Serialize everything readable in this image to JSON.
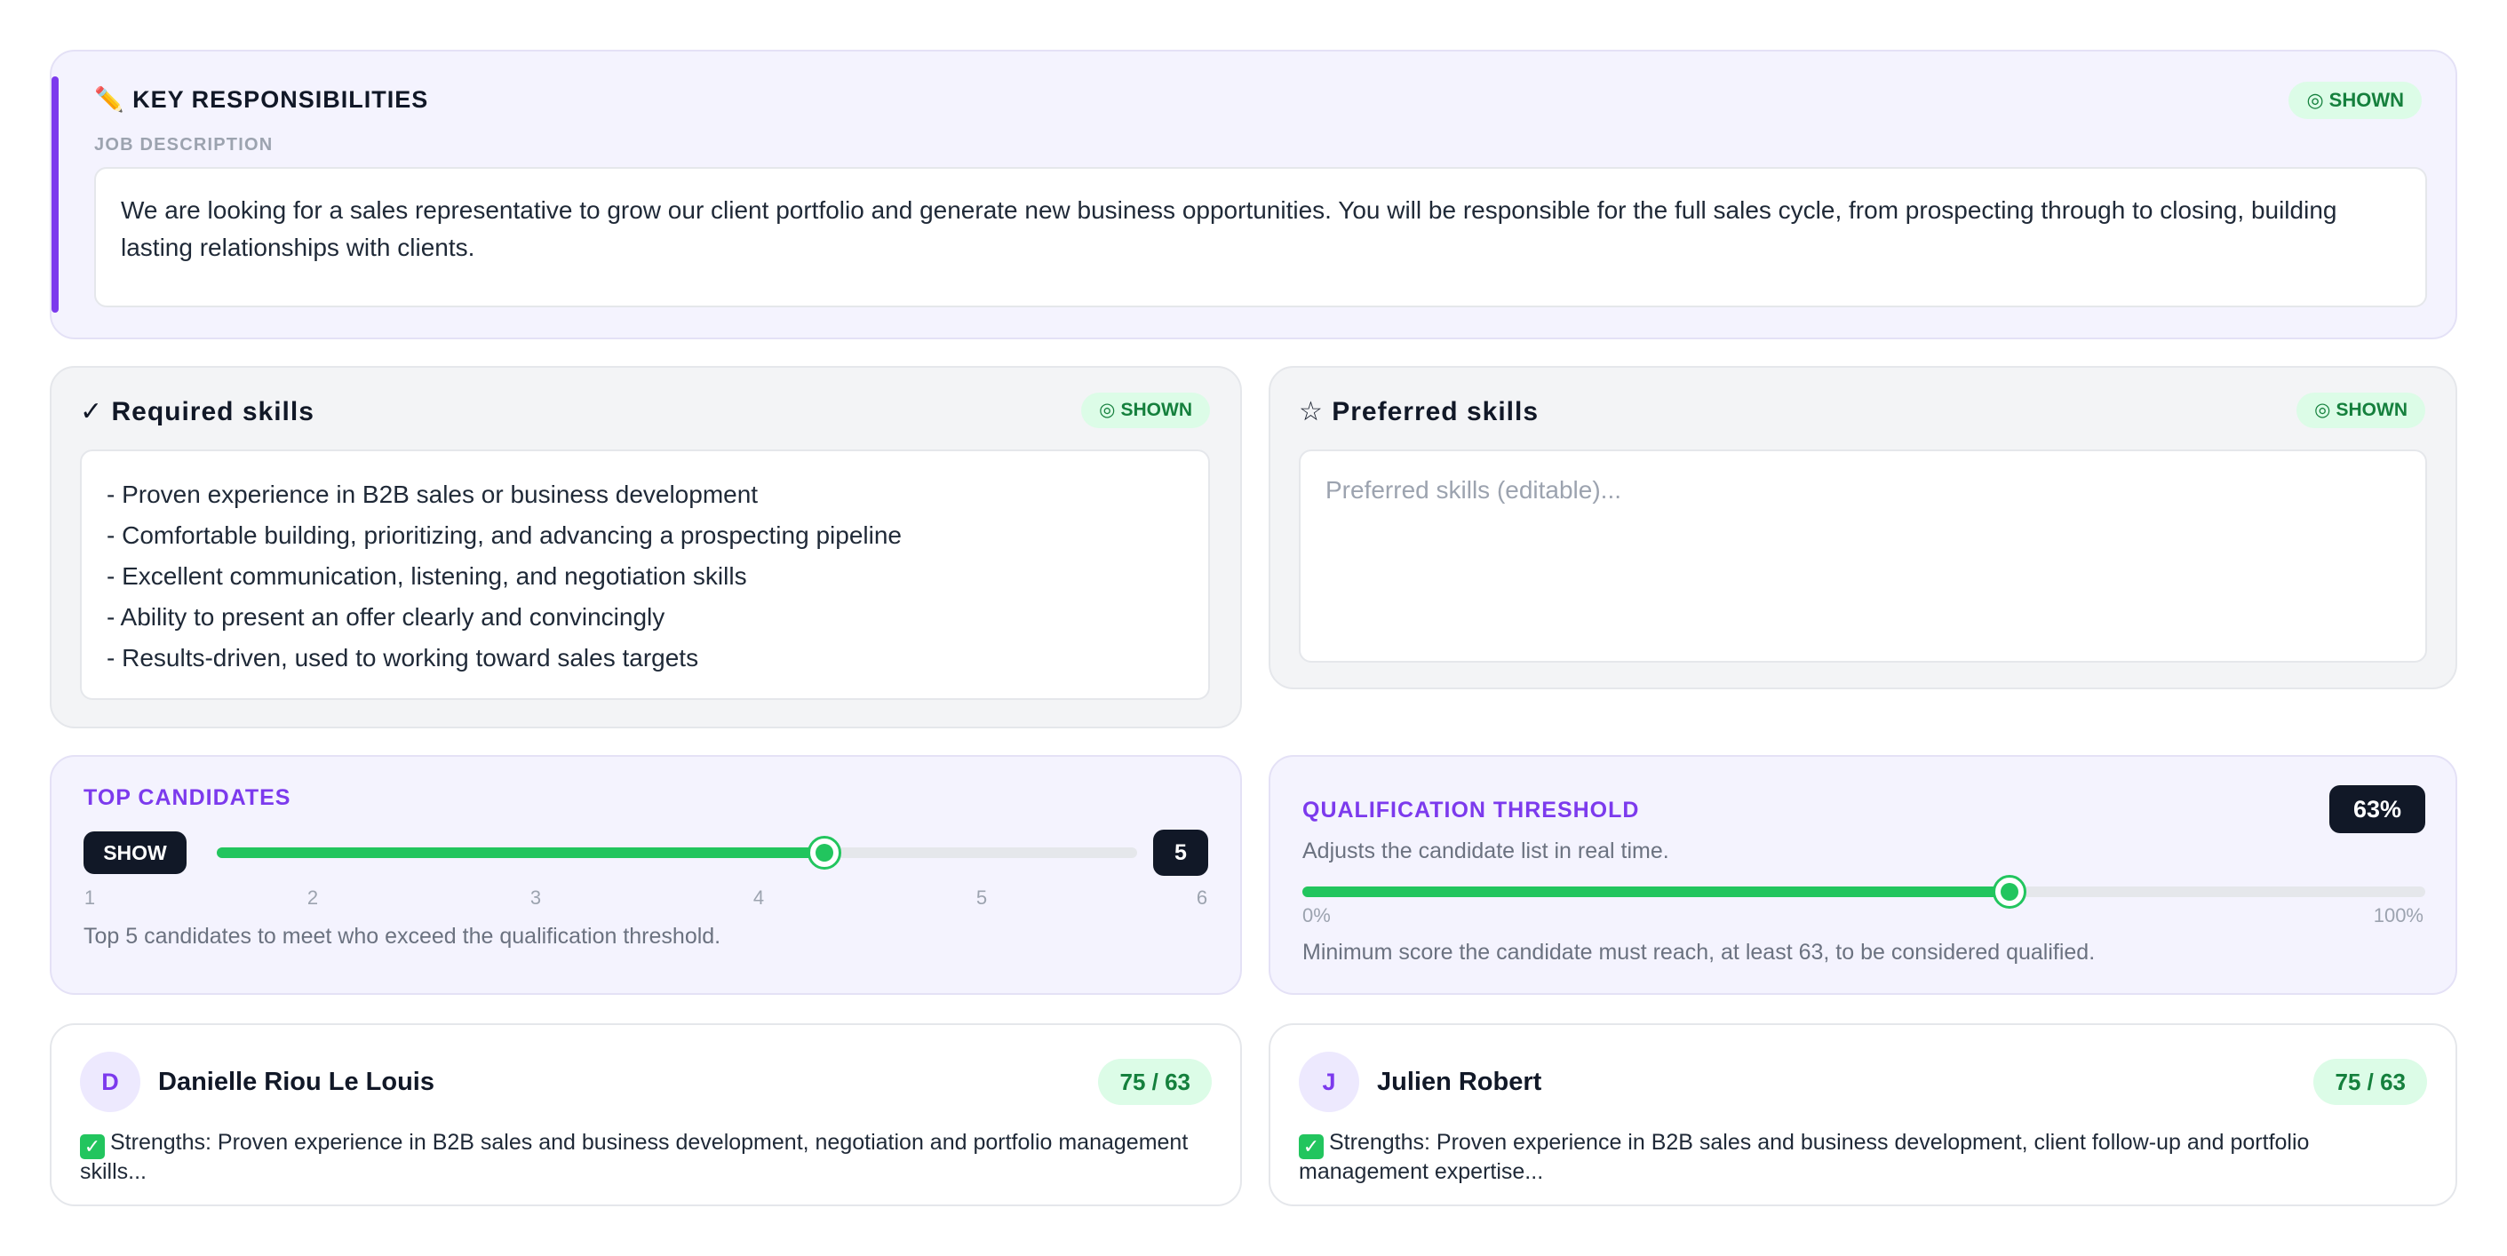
{
  "key_responsibilities": {
    "icon": "pencil-icon",
    "icon_glyph": "✏️",
    "title": "KEY RESPONSIBILITIES",
    "badge": "SHOWN",
    "badge_icon": "◎",
    "subtitle": "JOB DESCRIPTION",
    "description": "We are looking for a sales representative to grow our client portfolio and generate new business opportunities. You will be responsible for the full sales cycle, from prospecting through to closing, building lasting relationships with clients."
  },
  "required_skills": {
    "title": "✓ Required skills",
    "badge": "SHOWN",
    "badge_icon": "◎",
    "items": [
      "- Proven experience in B2B sales or business development",
      "- Comfortable building, prioritizing, and advancing a prospecting pipeline",
      "- Excellent communication, listening, and negotiation skills",
      "- Ability to present an offer clearly and convincingly",
      "- Results-driven, used to working toward sales targets"
    ]
  },
  "preferred_skills": {
    "title": "☆ Preferred skills",
    "badge": "SHOWN",
    "badge_icon": "◎",
    "placeholder": "Preferred skills (editable)..."
  },
  "top_candidates": {
    "title": "TOP CANDIDATES",
    "show_label": "SHOW",
    "value": "5",
    "slider_fraction": 0.66,
    "ticks": [
      "1",
      "2",
      "3",
      "4",
      "5",
      "6"
    ],
    "description": "Top 5 candidates to meet who exceed the qualification threshold."
  },
  "qualification": {
    "title": "QUALIFICATION THRESHOLD",
    "value": "63%",
    "slider_percent": 63,
    "adjust_text": "Adjusts the candidate list in real time.",
    "min_label": "0%",
    "max_label": "100%",
    "description": "Minimum score the candidate must reach, at least 63, to be considered qualified."
  },
  "candidates": [
    {
      "initial": "D",
      "name": "Danielle Riou Le Louis",
      "score": "75 / 63",
      "strengths": "Strengths: Proven experience in B2B sales and business development, negotiation and portfolio management skills..."
    },
    {
      "initial": "J",
      "name": "Julien Robert",
      "score": "75 / 63",
      "strengths": "Strengths: Proven experience in B2B sales and business development, client follow-up and portfolio management expertise..."
    }
  ],
  "colors": {
    "accent_purple": "#7c3aed",
    "success_green": "#22c55e",
    "badge_green_text": "#15803d",
    "dark_pill": "#111827"
  }
}
